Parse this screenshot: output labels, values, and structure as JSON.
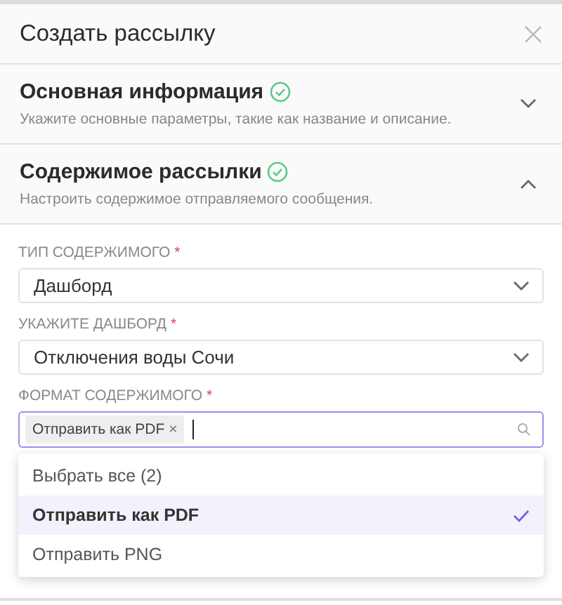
{
  "dialog": {
    "title": "Создать рассылку"
  },
  "sections": [
    {
      "title": "Основная информация",
      "subtitle": "Укажите основные параметры, такие как название и описание.",
      "completed": true,
      "expanded": false
    },
    {
      "title": "Содержимое рассылки",
      "subtitle": "Настроить содержимое отправляемого сообщения.",
      "completed": true,
      "expanded": true
    }
  ],
  "fields": [
    {
      "kind": "select",
      "label": "ТИП СОДЕРЖИМОГО",
      "required_mark": "*",
      "value": "Дашборд"
    },
    {
      "kind": "select",
      "label": "УКАЖИТЕ ДАШБОРД",
      "required_mark": "*",
      "value": "Отключения воды Сочи"
    },
    {
      "kind": "multiselect",
      "label": "ФОРМАТ СОДЕРЖИМОГО",
      "required_mark": "*",
      "focused": true,
      "tags": [
        {
          "label": "Отправить как PDF",
          "remove": "×"
        }
      ],
      "options": [
        {
          "label": "Выбрать все (2)",
          "selected": false
        },
        {
          "label": "Отправить как PDF",
          "selected": true
        },
        {
          "label": "Отправить PNG",
          "selected": false
        }
      ]
    }
  ]
}
